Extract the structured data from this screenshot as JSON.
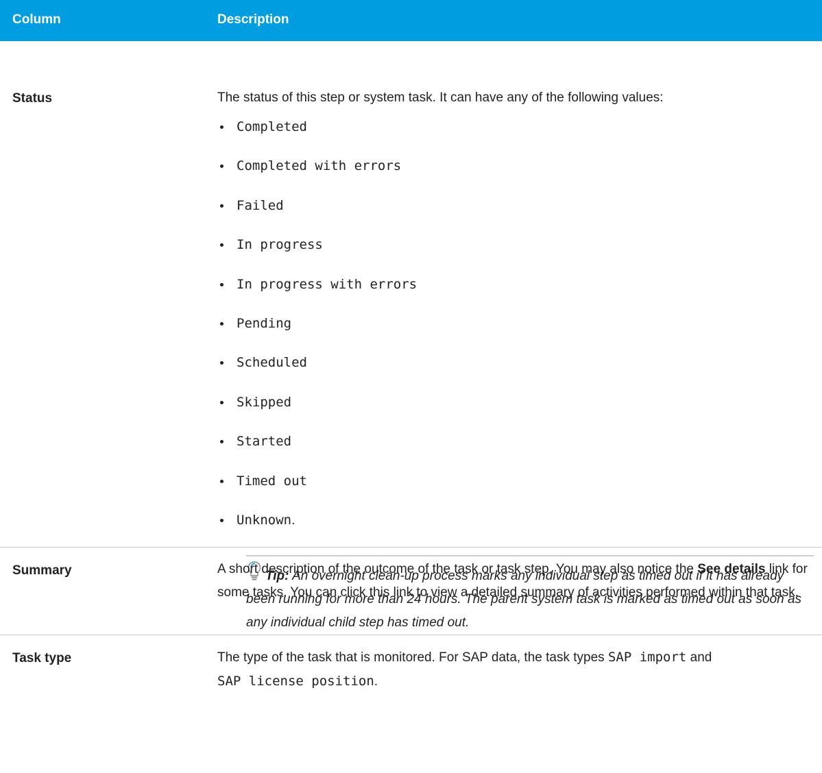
{
  "header": {
    "column_label": "Column",
    "description_label": "Description"
  },
  "status_row": {
    "label": "Status",
    "intro": "The status of this step or system task. It can have any of the following values:",
    "values": [
      "Completed",
      "Completed with errors",
      "Failed",
      "In progress",
      "In progress with errors",
      "Pending",
      "Scheduled",
      "Skipped",
      "Started",
      "Timed out",
      "Unknown"
    ],
    "last_value_suffix": ".",
    "tip": {
      "icon": "lightbulb-icon",
      "prefix": "Tip:",
      "text": "An overnight clean-up process marks any individual step as timed out if it has already been running for more than 24 hours. The parent system task is marked as timed out as soon as any individual child step has timed out."
    }
  },
  "summary_row": {
    "label": "Summary",
    "text_before": "A short description of the outcome of the task or task step. You may also notice the ",
    "bold_link": "See details",
    "text_after": " link for some tasks. You can click this link to view a detailed summary of activities performed within that task."
  },
  "tasktype_row": {
    "label": "Task type",
    "text_before": "The type of the task that is monitored. For SAP data, the task types ",
    "code1": "SAP import",
    "text_middle": " and ",
    "code2": "SAP license position",
    "text_after": "."
  },
  "colors": {
    "header_bg": "#009ee0",
    "header_text": "#ffffff",
    "divider": "#c8c8c8"
  }
}
